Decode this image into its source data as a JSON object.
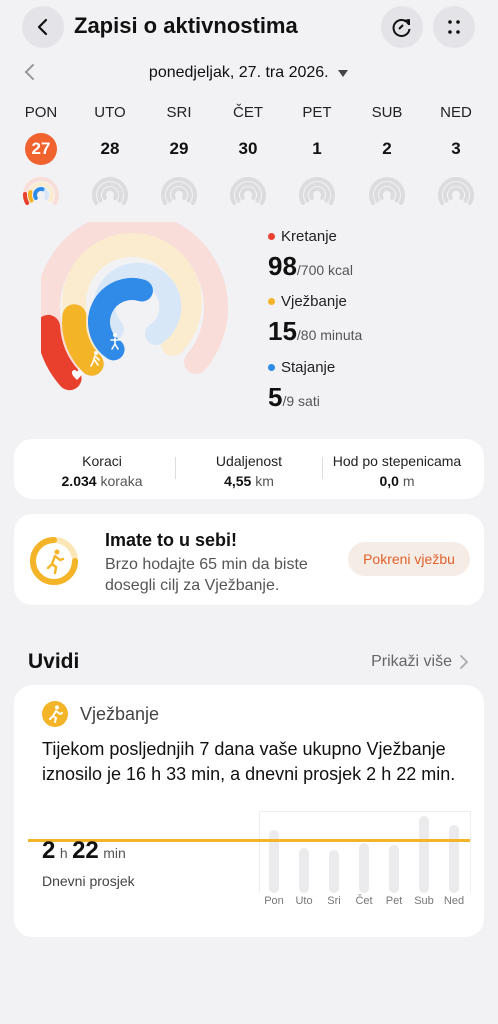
{
  "header": {
    "title": "Zapisi o aktivnostima",
    "back_icon": "back-arrow-icon",
    "actions": [
      "refresh-icon",
      "more-dots-icon"
    ]
  },
  "date": {
    "label": "ponedjeljak, 27. tra 2026."
  },
  "week": {
    "days": [
      {
        "name": "PON",
        "num": "27",
        "active": true
      },
      {
        "name": "UTO",
        "num": "28",
        "active": false
      },
      {
        "name": "SRI",
        "num": "29",
        "active": false
      },
      {
        "name": "ČET",
        "num": "30",
        "active": false
      },
      {
        "name": "PET",
        "num": "1",
        "active": false
      },
      {
        "name": "SUB",
        "num": "2",
        "active": false
      },
      {
        "name": "NED",
        "num": "3",
        "active": false
      }
    ]
  },
  "rings": {
    "colors": {
      "move": "#e8402c",
      "exercise": "#f4b428",
      "stand": "#2f8ae8"
    },
    "move_fraction": 0.14,
    "exercise_fraction": 0.19,
    "stand_fraction": 0.56
  },
  "legend": {
    "move": {
      "label": "Kretanje",
      "value": "98",
      "unit": "/700 kcal"
    },
    "exercise": {
      "label": "Vježbanje",
      "value": "15",
      "unit": "/80 minuta"
    },
    "stand": {
      "label": "Stajanje",
      "value": "5",
      "unit": "/9 sati"
    }
  },
  "stats": {
    "steps": {
      "label": "Koraci",
      "value": "2.034",
      "unit": "koraka"
    },
    "distance": {
      "label": "Udaljenost",
      "value": "4,55",
      "unit": "km"
    },
    "stairs": {
      "label": "Hod po stepenicama",
      "value": "0,0",
      "unit": "m"
    }
  },
  "promo": {
    "title": "Imate to u sebi!",
    "text": "Brzo hodajte 65 min da biste dosegli cilj za Vježbanje.",
    "button": "Pokreni vježbu"
  },
  "insights": {
    "title": "Uvidi",
    "more": "Prikaži više",
    "card": {
      "heading": "Vježbanje",
      "body": "Tijekom posljednjih 7 dana vaše ukupno Vježbanje iznosilo je 16 h 33 min, a dnevni prosjek 2 h 22 min.",
      "avg_h": "2",
      "avg_h_unit": "h",
      "avg_m": "22",
      "avg_m_unit": "min",
      "avg_label": "Dnevni prosjek",
      "bar_labels": [
        "Pon",
        "Uto",
        "Sri",
        "Čet",
        "Pet",
        "Sub",
        "Ned"
      ],
      "bar_fractions": [
        0.7,
        0.5,
        0.48,
        0.56,
        0.53,
        0.86,
        0.75
      ]
    }
  }
}
